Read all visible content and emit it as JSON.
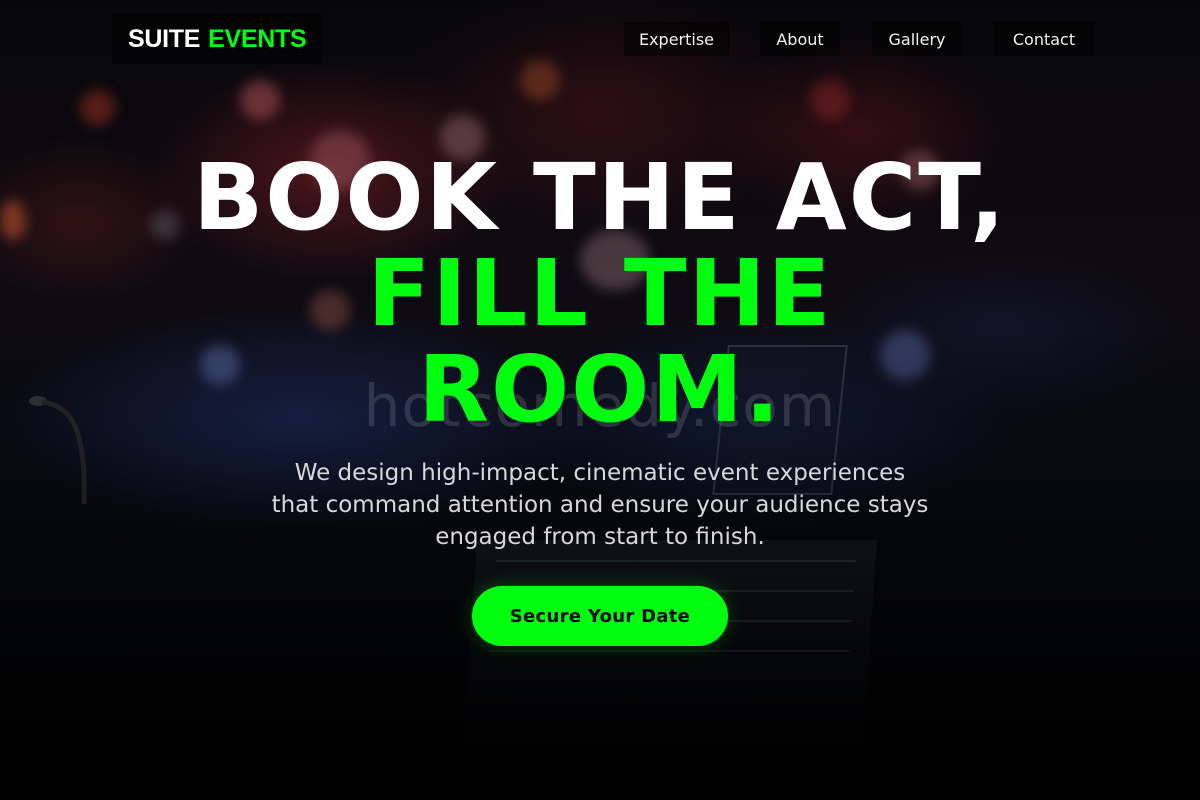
{
  "brand": {
    "part1": "SUITE",
    "part2": "EVENTS",
    "accent_color": "#00ff0f"
  },
  "nav": {
    "items": [
      {
        "label": "Expertise"
      },
      {
        "label": "About"
      },
      {
        "label": "Gallery"
      },
      {
        "label": "Contact"
      }
    ]
  },
  "hero": {
    "headline_line1": "BOOK THE ACT,",
    "headline_line2": "FILL THE ROOM.",
    "watermark": "hotcomedy.com",
    "subtitle": "We design high-impact, cinematic event experiences that command attention and ensure your audience stays engaged from start to finish.",
    "cta_label": "Secure Your Date"
  }
}
